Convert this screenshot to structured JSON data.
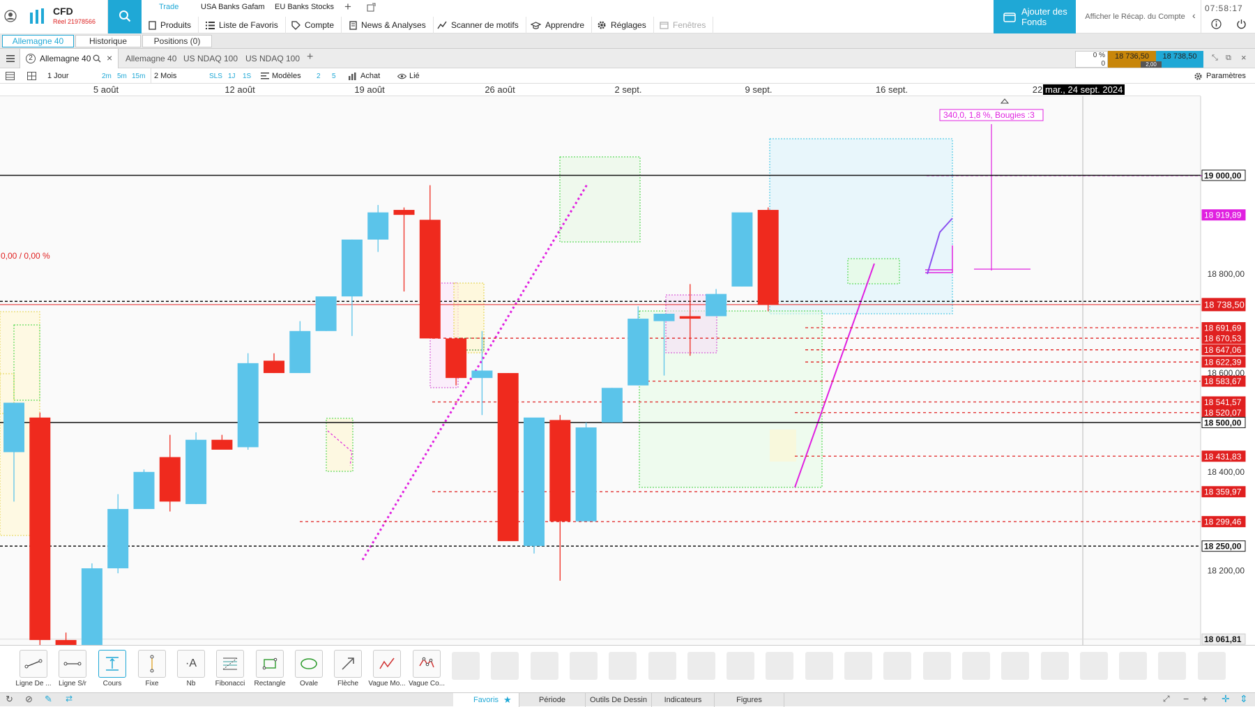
{
  "app": {
    "brand": "CFD",
    "account": "Réel 21978566",
    "clock": "07:58:17"
  },
  "top_tabs": [
    "Trade",
    "USA Banks Gafam",
    "EU Banks Stocks"
  ],
  "nav": [
    "Produits",
    "Liste de Favoris",
    "Compte",
    "News & Analyses",
    "Scanner de motifs",
    "Apprendre",
    "Réglages",
    "Fenêtres"
  ],
  "add_funds": "Ajouter des Fonds",
  "recap": "Afficher le Récap. du Compte",
  "position_tabs": [
    "Allemagne 40",
    "Historique",
    "Positions (0)"
  ],
  "chart_tabs": {
    "badge": "2",
    "active": "Allemagne 40",
    "others": [
      "Allemagne 40",
      "US NDAQ 100",
      "US NDAQ 100"
    ]
  },
  "quote": {
    "pct": "0 %",
    "zero": "0",
    "bid": "18 736,50",
    "ask": "18 738,50",
    "spread": "2,00"
  },
  "toolbar": {
    "interval": "1 Jour",
    "t1": "2m",
    "t2": "5m",
    "t3": "15m",
    "range": "2 Mois",
    "sls": "SLS",
    "j": "1J",
    "s": "1S",
    "models": "Modèles",
    "n2": "2",
    "n5": "5",
    "buy": "Achat",
    "linked": "Lié",
    "params": "Paramètres"
  },
  "colors": {
    "bull": "#5bc4ea",
    "bear": "#ef2a1e",
    "accent": "#1fa8d6",
    "magenta": "#e020e0"
  },
  "chart_data": {
    "type": "candlestick",
    "x_ticks": [
      "5 août",
      "12 août",
      "19 août",
      "26 août",
      "2 sept.",
      "9 sept.",
      "16 sept.",
      "22"
    ],
    "crosshair_date": "mar., 24 sept. 2024",
    "y_ticks": [
      "18 800,00",
      "18 600,00",
      "18 400,00",
      "18 200,00"
    ],
    "ylim": [
      18050,
      19160
    ],
    "candles": [
      {
        "o": 18440,
        "h": 18480,
        "l": 18340,
        "c": 18540
      },
      {
        "o": 18510,
        "h": 18520,
        "l": 18010,
        "c": 18060
      },
      {
        "o": 18060,
        "h": 18075,
        "l": 18050,
        "c": 18045
      },
      {
        "o": 18050,
        "h": 18215,
        "l": 18050,
        "c": 18205
      },
      {
        "o": 18205,
        "h": 18355,
        "l": 18195,
        "c": 18325
      },
      {
        "o": 18325,
        "h": 18405,
        "l": 18325,
        "c": 18400
      },
      {
        "o": 18430,
        "h": 18475,
        "l": 18320,
        "c": 18340
      },
      {
        "o": 18335,
        "h": 18480,
        "l": 18335,
        "c": 18465
      },
      {
        "o": 18465,
        "h": 18475,
        "l": 18465,
        "c": 18445
      },
      {
        "o": 18450,
        "h": 18640,
        "l": 18445,
        "c": 18620
      },
      {
        "o": 18625,
        "h": 18640,
        "l": 18600,
        "c": 18600
      },
      {
        "o": 18600,
        "h": 18705,
        "l": 18600,
        "c": 18685
      },
      {
        "o": 18685,
        "h": 18735,
        "l": 18685,
        "c": 18755
      },
      {
        "o": 18755,
        "h": 18870,
        "l": 18675,
        "c": 18870
      },
      {
        "o": 18870,
        "h": 18940,
        "l": 18845,
        "c": 18925
      },
      {
        "o": 18930,
        "h": 18935,
        "l": 18765,
        "c": 18920
      },
      {
        "o": 18910,
        "h": 18980,
        "l": 18670,
        "c": 18670
      },
      {
        "o": 18670,
        "h": 18670,
        "l": 18575,
        "c": 18590
      },
      {
        "o": 18590,
        "h": 18685,
        "l": 18515,
        "c": 18605
      },
      {
        "o": 18600,
        "h": 18600,
        "l": 18265,
        "c": 18260
      },
      {
        "o": 18250,
        "h": 18505,
        "l": 18235,
        "c": 18510
      },
      {
        "o": 18505,
        "h": 18515,
        "l": 18180,
        "c": 18300
      },
      {
        "o": 18300,
        "h": 18500,
        "l": 18300,
        "c": 18490
      },
      {
        "o": 18500,
        "h": 18570,
        "l": 18500,
        "c": 18570
      },
      {
        "o": 18575,
        "h": 18735,
        "l": 18575,
        "c": 18710
      },
      {
        "o": 18705,
        "h": 18710,
        "l": 18595,
        "c": 18720
      },
      {
        "o": 18715,
        "h": 18780,
        "l": 18635,
        "c": 18710
      },
      {
        "o": 18715,
        "h": 18770,
        "l": 18715,
        "c": 18760
      },
      {
        "o": 18775,
        "h": 18920,
        "l": 18775,
        "c": 18925
      },
      {
        "o": 18930,
        "h": 18935,
        "l": 18725,
        "c": 18738
      }
    ],
    "hlines": [
      {
        "v": 19000,
        "label": "19 000,00",
        "style": "black"
      },
      {
        "v": 18919.89,
        "label": "18 919,89",
        "style": "magenta"
      },
      {
        "v": 18738.5,
        "label": "18 738,50",
        "style": "red"
      },
      {
        "v": 18691.69,
        "label": "18 691,69",
        "style": "red"
      },
      {
        "v": 18670.53,
        "label": "18 670,53",
        "style": "red"
      },
      {
        "v": 18647.06,
        "label": "18 647,06",
        "style": "red"
      },
      {
        "v": 18622.39,
        "label": "18 622,39",
        "style": "red"
      },
      {
        "v": 18583.67,
        "label": "18 583,67",
        "style": "red"
      },
      {
        "v": 18541.57,
        "label": "18 541,57",
        "style": "red"
      },
      {
        "v": 18520.07,
        "label": "18 520,07",
        "style": "red"
      },
      {
        "v": 18500,
        "label": "18 500,00",
        "style": "black"
      },
      {
        "v": 18431.83,
        "label": "18 431,83",
        "style": "red"
      },
      {
        "v": 18359.97,
        "label": "18 359,97",
        "style": "red"
      },
      {
        "v": 18299.46,
        "label": "18 299,46",
        "style": "red"
      },
      {
        "v": 18250,
        "label": "18 250,00",
        "style": "black"
      },
      {
        "v": 18061.81,
        "label": "18 061,81",
        "style": "gray"
      }
    ],
    "pct_label": "0,00 / 0,00 %",
    "measure_label": "340,0, 1,8 %, Bougies :3"
  },
  "draw_tools": [
    "Ligne De ...",
    "Ligne S/r",
    "Cours",
    "Fixe",
    "Nb",
    "Fibonacci",
    "Rectangle",
    "Ovale",
    "Flèche",
    "Vague Mo...",
    "Vague Co..."
  ],
  "bottom_tabs": [
    "Favoris",
    "Période",
    "Outils De Dessin",
    "Indicateurs",
    "Figures"
  ]
}
